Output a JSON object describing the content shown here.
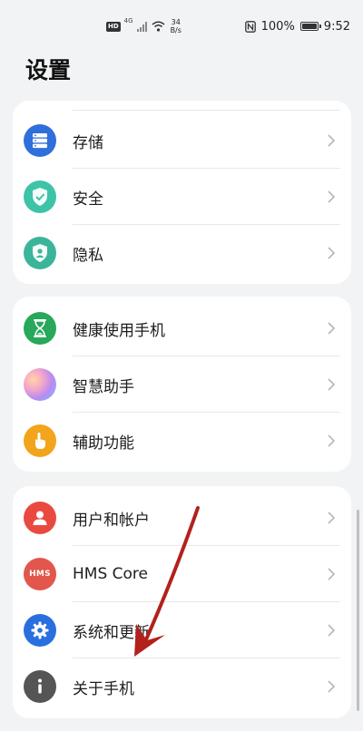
{
  "status_bar": {
    "hd_badge": "HD",
    "signal_label": "4G",
    "speed_value": "34",
    "speed_unit": "B/s",
    "battery": "100%",
    "time": "9:52"
  },
  "page": {
    "title": "设置"
  },
  "groups": [
    {
      "items": [
        {
          "label": "存储",
          "icon": "storage-icon",
          "color": "#2f6fdc"
        },
        {
          "label": "安全",
          "icon": "shield-check-icon",
          "color": "#3ec3a8"
        },
        {
          "label": "隐私",
          "icon": "privacy-icon",
          "color": "#3ab59a"
        }
      ]
    },
    {
      "items": [
        {
          "label": "健康使用手机",
          "icon": "hourglass-icon",
          "color": "#27a85a"
        },
        {
          "label": "智慧助手",
          "icon": "assistant-orb-icon",
          "color": "#b98bf2"
        },
        {
          "label": "辅助功能",
          "icon": "accessibility-hand-icon",
          "color": "#f2a41c"
        }
      ]
    },
    {
      "items": [
        {
          "label": "用户和帐户",
          "icon": "user-icon",
          "color": "#e94a3f"
        },
        {
          "label": "HMS Core",
          "icon": "hms-icon",
          "color": "#e2564c",
          "icon_text": "HMS"
        },
        {
          "label": "系统和更新",
          "icon": "gear-icon",
          "color": "#2a6fe0"
        },
        {
          "label": "关于手机",
          "icon": "info-icon",
          "color": "#555555"
        }
      ]
    }
  ]
}
